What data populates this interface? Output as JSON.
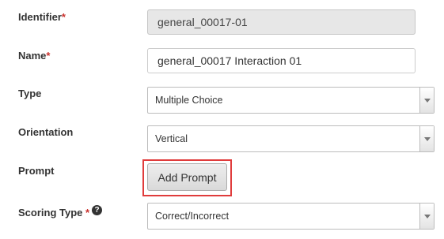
{
  "form": {
    "identifier": {
      "label": "Identifier",
      "required_mark": "*",
      "value": "general_00017-01"
    },
    "name": {
      "label": "Name",
      "required_mark": "*",
      "value": "general_00017 Interaction 01"
    },
    "type": {
      "label": "Type",
      "selected": "Multiple Choice"
    },
    "orientation": {
      "label": "Orientation",
      "selected": "Vertical"
    },
    "prompt": {
      "label": "Prompt",
      "button_label": "Add Prompt"
    },
    "scoring_type": {
      "label": "Scoring Type",
      "required_mark": "*",
      "help_icon": "?",
      "selected": "Correct/Incorrect"
    }
  },
  "colors": {
    "required": "#c9302c",
    "highlight": "#e03c3c",
    "readonly_bg": "#e7e7e7"
  },
  "icons": {
    "dropdown": "chevron-down-icon",
    "help": "question-circle-icon"
  }
}
